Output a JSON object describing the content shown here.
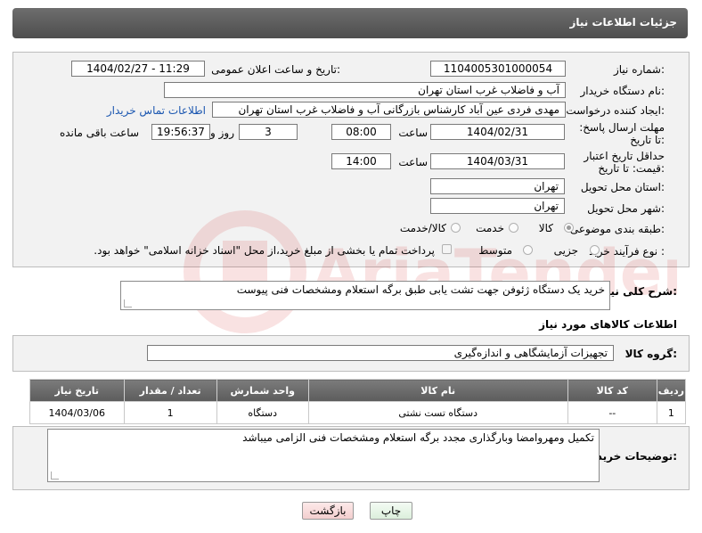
{
  "header": {
    "title": "جزئیات اطلاعات نیاز"
  },
  "form": {
    "need_number": {
      "label": "شماره نیاز:",
      "value": "1104005301000054"
    },
    "announce_date": {
      "label": "تاریخ و ساعت اعلان عمومی:",
      "value": "1404/02/27 - 11:29"
    },
    "buyer_org": {
      "label": "نام دستگاه خریدار:",
      "value": "آب و فاضلاب غرب استان تهران"
    },
    "requester": {
      "label": "ایجاد کننده درخواست:",
      "value": "مهدی فردی عین آباد کارشناس بازرگانی آب و فاضلاب غرب استان تهران",
      "contact_link": "اطلاعات تماس خریدار"
    },
    "reply_deadline": {
      "label": "مهلت ارسال پاسخ: تا تاریخ:",
      "date": "1404/02/31",
      "time_label": "ساعت",
      "time": "08:00",
      "days": "3",
      "days_label": "روز و",
      "remaining": "19:56:37",
      "remaining_label": "ساعت باقی مانده"
    },
    "price_validity": {
      "label": "حداقل تاریخ اعتبار قیمت: تا تاریخ:",
      "date": "1404/03/31",
      "time_label": "ساعت",
      "time": "14:00"
    },
    "delivery_province": {
      "label": "استان محل تحویل:",
      "value": "تهران"
    },
    "delivery_city": {
      "label": "شهر محل تحویل:",
      "value": "تهران"
    },
    "category": {
      "label": "طبقه بندی موضوعی:",
      "options": [
        "کالا",
        "خدمت",
        "کالا/خدمت"
      ],
      "selected": "کالا"
    },
    "purchase_type": {
      "label": "نوع فرآیند خرید :",
      "options": [
        "جزیی",
        "متوسط"
      ],
      "selected": "",
      "payment_note": "پرداخت تمام یا بخشی از مبلغ خرید،از محل \"اسناد خزانه اسلامی\" خواهد بود."
    }
  },
  "description": {
    "label": "شرح کلی نیاز:",
    "value": "خرید یک دستگاه ژئوفن جهت تشت یابی طبق برگه استعلام ومشخصات فنی پیوست"
  },
  "goods_info": {
    "title": "اطلاعات کالاهای مورد نیاز",
    "group_label": "گروه کالا:",
    "group_value": "تجهیزات آزمایشگاهی و اندازه‌گیری"
  },
  "table": {
    "headers": [
      "ردیف",
      "کد کالا",
      "نام کالا",
      "واحد شمارش",
      "تعداد / مقدار",
      "تاریخ نیاز"
    ],
    "rows": [
      [
        "1",
        "--",
        "دستگاه تست نشتی",
        "دستگاه",
        "1",
        "1404/03/06"
      ]
    ]
  },
  "buyer_notes": {
    "label": "توضیحات خریدار:",
    "value": "تکمیل ومهروامضا وبارگذاری مجدد برگه استعلام ومشخصات فنی الزامی میباشد"
  },
  "buttons": {
    "print": "چاپ",
    "back": "بازگشت"
  },
  "colors": {
    "header_bg": "#5c5c5c",
    "link": "#1a56b0",
    "back_button": "#f6d6d6",
    "print_button": "#e6f5e6"
  }
}
